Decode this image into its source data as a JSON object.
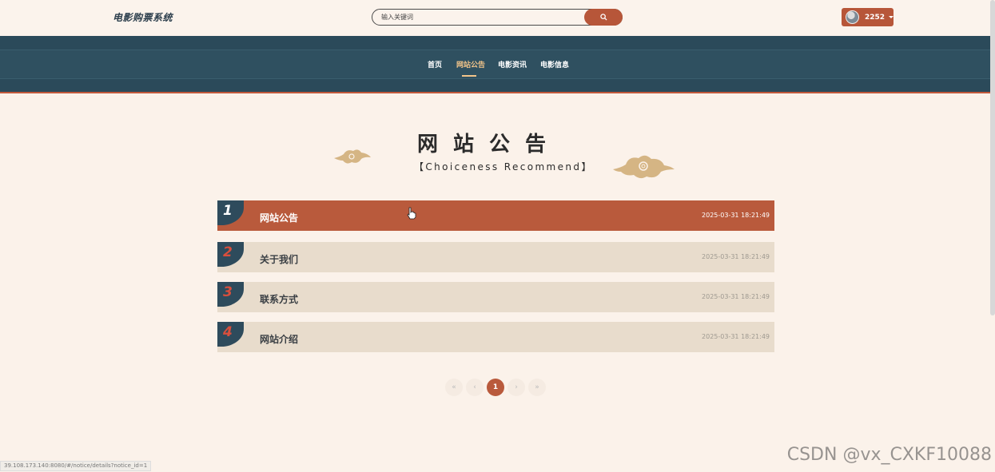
{
  "header": {
    "logo": "电影购票系统",
    "search_placeholder": "输入关键词",
    "user_name": "2252"
  },
  "nav": {
    "items": [
      {
        "label": "首页",
        "active": false
      },
      {
        "label": "网站公告",
        "active": true
      },
      {
        "label": "电影资讯",
        "active": false
      },
      {
        "label": "电影信息",
        "active": false
      }
    ]
  },
  "section": {
    "title": "网站公告",
    "subtitle": "【Choiceness Recommend】"
  },
  "notices": [
    {
      "num": "1",
      "title": "网站公告",
      "time": "2025-03-31 18:21:49"
    },
    {
      "num": "2",
      "title": "关于我们",
      "time": "2025-03-31 18:21:49"
    },
    {
      "num": "3",
      "title": "联系方式",
      "time": "2025-03-31 18:21:49"
    },
    {
      "num": "4",
      "title": "网站介绍",
      "time": "2025-03-31 18:21:49"
    }
  ],
  "pagination": {
    "first": "«",
    "prev": "‹",
    "current": "1",
    "next": "›",
    "last": "»"
  },
  "status_url": "39.108.173.140:8080/#/notice/details?notice_id=1",
  "watermark": "CSDN @vx_CXKF10088",
  "colors": {
    "accent": "#b95a3c",
    "nav_bg": "#2b4a5a",
    "page_bg": "#fbf2ea",
    "row_bg": "#e8dccc",
    "nav_active": "#f3c58a"
  }
}
